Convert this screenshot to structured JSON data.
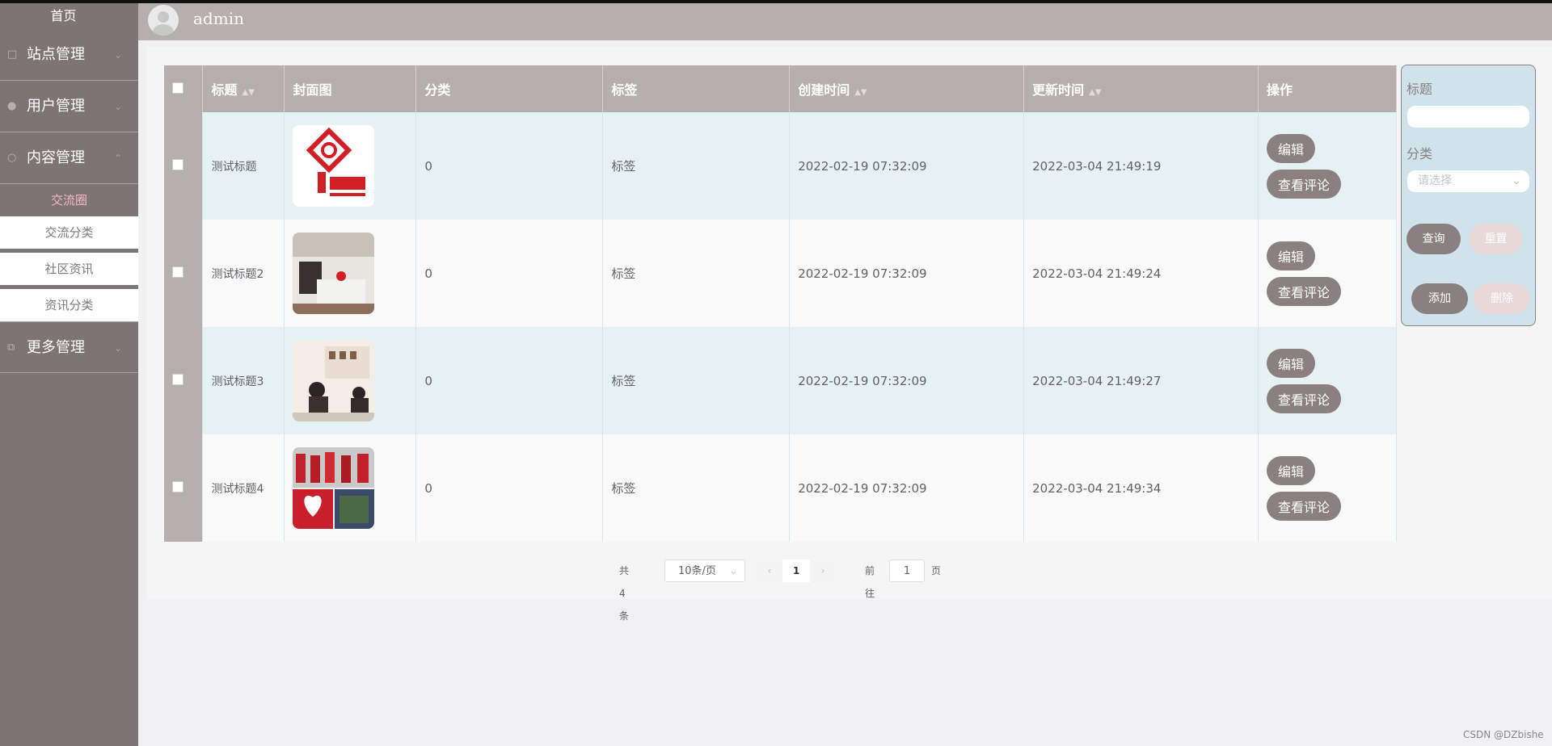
{
  "sidebar": {
    "home": "首页",
    "menus": [
      {
        "label": "站点管理"
      },
      {
        "label": "用户管理"
      },
      {
        "label": "内容管理"
      },
      {
        "label": "更多管理"
      }
    ],
    "submenu": [
      "交流圈",
      "交流分类",
      "社区资讯",
      "资讯分类"
    ]
  },
  "header": {
    "username": "admin"
  },
  "table": {
    "columns": [
      "标题",
      "封面图",
      "分类",
      "标签",
      "创建时间",
      "更新时间",
      "操作"
    ],
    "rows": [
      {
        "title": "测试标题",
        "category": "0",
        "tag": "标签",
        "created": "2022-02-19 07:32:09",
        "updated": "2022-03-04 21:49:19"
      },
      {
        "title": "测试标题2",
        "category": "0",
        "tag": "标签",
        "created": "2022-02-19 07:32:09",
        "updated": "2022-03-04 21:49:24"
      },
      {
        "title": "测试标题3",
        "category": "0",
        "tag": "标签",
        "created": "2022-02-19 07:32:09",
        "updated": "2022-03-04 21:49:27"
      },
      {
        "title": "测试标题4",
        "category": "0",
        "tag": "标签",
        "created": "2022-02-19 07:32:09",
        "updated": "2022-03-04 21:49:34"
      }
    ],
    "edit_label": "编辑",
    "comment_label": "查看评论"
  },
  "pager": {
    "total": "共 4 条",
    "size": "10条/页",
    "current": "1",
    "goto": "前往",
    "goto_value": "1",
    "page_suffix": "页"
  },
  "panel": {
    "title_label": "标题",
    "category_label": "分类",
    "select_placeholder": "请选择",
    "query": "查询",
    "reset": "重置",
    "add": "添加",
    "delete": "删除"
  },
  "watermark": "CSDN @DZbishe",
  "colors": {
    "sidebar": "#7d7575",
    "header": "#b7aeae",
    "accent": "#8a8080",
    "active_sub": "#f4b6c4"
  }
}
